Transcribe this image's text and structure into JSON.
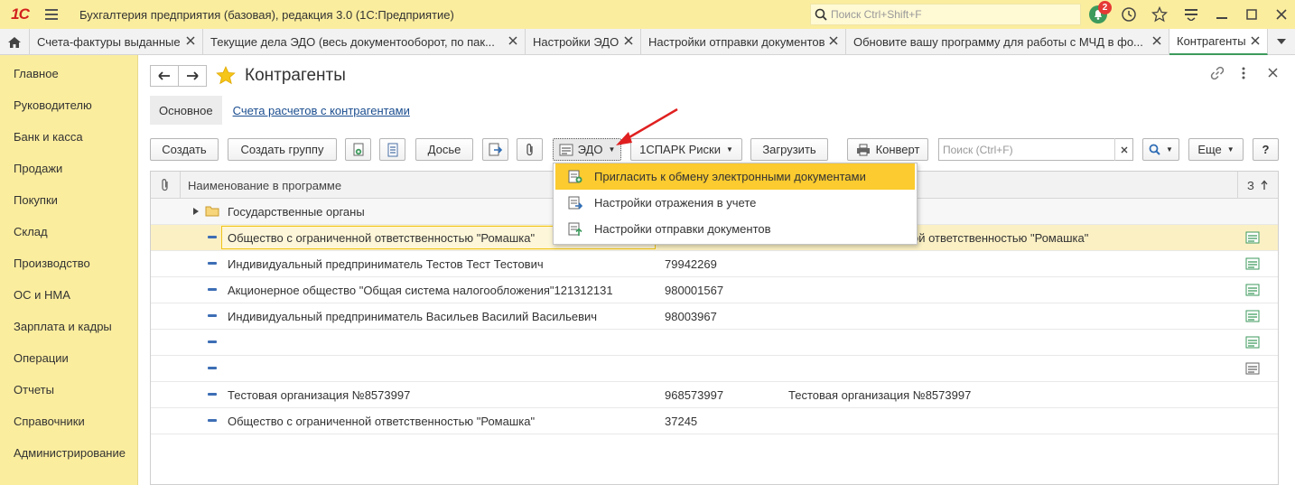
{
  "titlebar": {
    "logo": "1С",
    "title": "Бухгалтерия предприятия (базовая), редакция 3.0  (1С:Предприятие)",
    "search_placeholder": "Поиск Ctrl+Shift+F",
    "notifications_count": "2"
  },
  "tabs": [
    {
      "label": "Счета-фактуры выданные"
    },
    {
      "label": "Текущие дела ЭДО (весь документооборот, по пак..."
    },
    {
      "label": "Настройки ЭДО"
    },
    {
      "label": "Настройки отправки документов"
    },
    {
      "label": "Обновите вашу программу для работы с МЧД в фо..."
    },
    {
      "label": "Контрагенты"
    }
  ],
  "sidebar": {
    "items": [
      {
        "label": "Главное"
      },
      {
        "label": "Руководителю"
      },
      {
        "label": "Банк и касса"
      },
      {
        "label": "Продажи"
      },
      {
        "label": "Покупки"
      },
      {
        "label": "Склад"
      },
      {
        "label": "Производство"
      },
      {
        "label": "ОС и НМА"
      },
      {
        "label": "Зарплата и кадры"
      },
      {
        "label": "Операции"
      },
      {
        "label": "Отчеты"
      },
      {
        "label": "Справочники"
      },
      {
        "label": "Администрирование"
      }
    ]
  },
  "page": {
    "title": "Контрагенты",
    "subtab_main": "Основное",
    "subtab_link": "Счета расчетов с контрагентами"
  },
  "toolbar": {
    "create": "Создать",
    "create_group": "Создать группу",
    "dossier": "Досье",
    "edo": "ЭДО",
    "spark": "1СПАРК Риски",
    "load": "Загрузить",
    "envelope": "Конверт",
    "search_placeholder": "Поиск (Ctrl+F)",
    "more": "Еще",
    "help": "?"
  },
  "table": {
    "col_name": "Наименование в программе",
    "col_sort": "З",
    "group_row": "Государственные органы",
    "rows": [
      {
        "name": "Общество с ограниченной ответственностью \"Ромашка\"",
        "inn": "",
        "full": "ой ответственностью \"Ромашка\""
      },
      {
        "name": "Индивидуальный предприниматель Тестов Тест Тестович",
        "inn": "79942269",
        "full": ""
      },
      {
        "name": "Акционерное общество \"Общая система налогообложения\"121312131",
        "inn": "980001567",
        "full": ""
      },
      {
        "name": "Индивидуальный предприниматель Васильев Василий Васильевич",
        "inn": "98003967",
        "full": ""
      },
      {
        "name": "",
        "inn": "",
        "full": ""
      },
      {
        "name": "",
        "inn": "",
        "full": ""
      },
      {
        "name": "Тестовая организация №8573997",
        "inn": "968573997",
        "full": "Тестовая организация №8573997"
      },
      {
        "name": "Общество с ограниченной ответственностью \"Ромашка\"",
        "inn": "37245",
        "full": ""
      }
    ]
  },
  "edo_menu": {
    "items": [
      {
        "label": "Пригласить к обмену электронными документами"
      },
      {
        "label": "Настройки отражения в учете"
      },
      {
        "label": "Настройки отправки документов"
      }
    ]
  },
  "colors": {
    "title_bar": "#fbed9e",
    "highlight": "#fbcb2f",
    "link": "#1a4d8f",
    "annotation_arrow": "#e02020"
  }
}
